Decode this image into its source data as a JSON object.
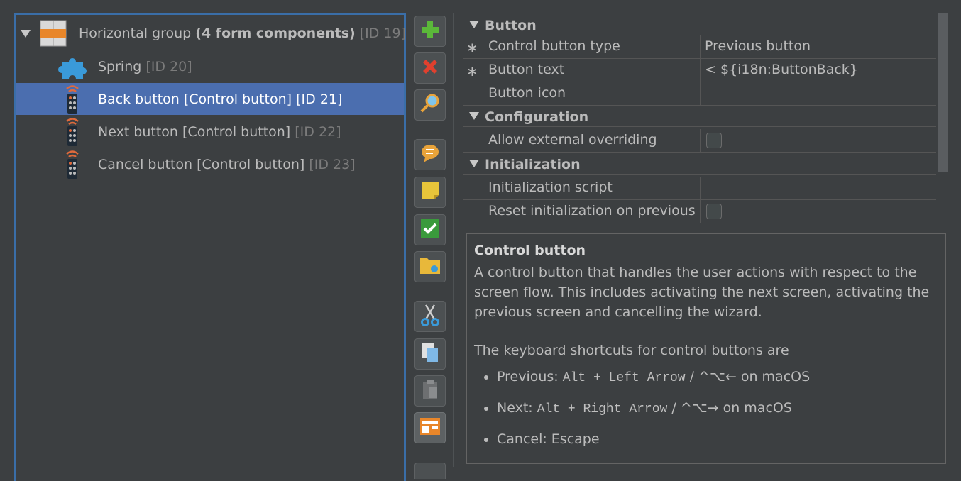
{
  "tree": {
    "items": [
      {
        "label": "Horizontal group ",
        "bold": "(4 form components)",
        "id": " [ID 19]",
        "icon": "horizontal-group-icon"
      },
      {
        "label": "Spring",
        "id": " [ID 20]",
        "icon": "puzzle-icon"
      },
      {
        "label": "Back button [Control button] [ID 21]",
        "icon": "remote-control-icon"
      },
      {
        "label": "Next button [Control button]",
        "id": " [ID 22]",
        "icon": "remote-control-icon"
      },
      {
        "label": "Cancel button [Control button]",
        "id": " [ID 23]",
        "icon": "remote-control-icon"
      }
    ]
  },
  "toolbar": {
    "buttons": [
      "add-icon",
      "delete-icon",
      "search-icon",
      "comment-icon",
      "note-icon",
      "check-icon",
      "folder-icon",
      "cut-icon",
      "copy-icon",
      "paste-icon",
      "form-icon"
    ]
  },
  "properties": {
    "sections": [
      {
        "title": "Button"
      },
      {
        "title": "Configuration"
      },
      {
        "title": "Initialization"
      }
    ],
    "rows": {
      "control_button_type": {
        "name": "Control button type",
        "value": "Previous button",
        "required": "∗"
      },
      "button_text": {
        "name": "Button text",
        "value": "< ${i18n:ButtonBack}",
        "required": "∗"
      },
      "button_icon": {
        "name": "Button icon",
        "value": ""
      },
      "allow_external": {
        "name": "Allow external overriding"
      },
      "init_script": {
        "name": "Initialization script",
        "value": ""
      },
      "reset_init": {
        "name": "Reset initialization on previous"
      }
    }
  },
  "description": {
    "title": "Control button",
    "paragraph1": "A control button that handles the user actions with respect to the screen flow. This includes activating the next screen, activating the previous screen and cancelling the wizard.",
    "paragraph2": "The keyboard shortcuts for control buttons are",
    "shortcuts": [
      {
        "prefix": "Previous: ",
        "keys": "Alt + Left Arrow",
        "suffix": " / ^⌥← on macOS"
      },
      {
        "prefix": "Next: ",
        "keys": "Alt + Right Arrow",
        "suffix": " / ^⌥→ on macOS"
      },
      {
        "prefix": "Cancel: Escape",
        "keys": "",
        "suffix": ""
      }
    ]
  },
  "colors": {
    "background": "#3c3f41",
    "selection": "#4b6eaf",
    "tree_border": "#3a6ea8"
  }
}
